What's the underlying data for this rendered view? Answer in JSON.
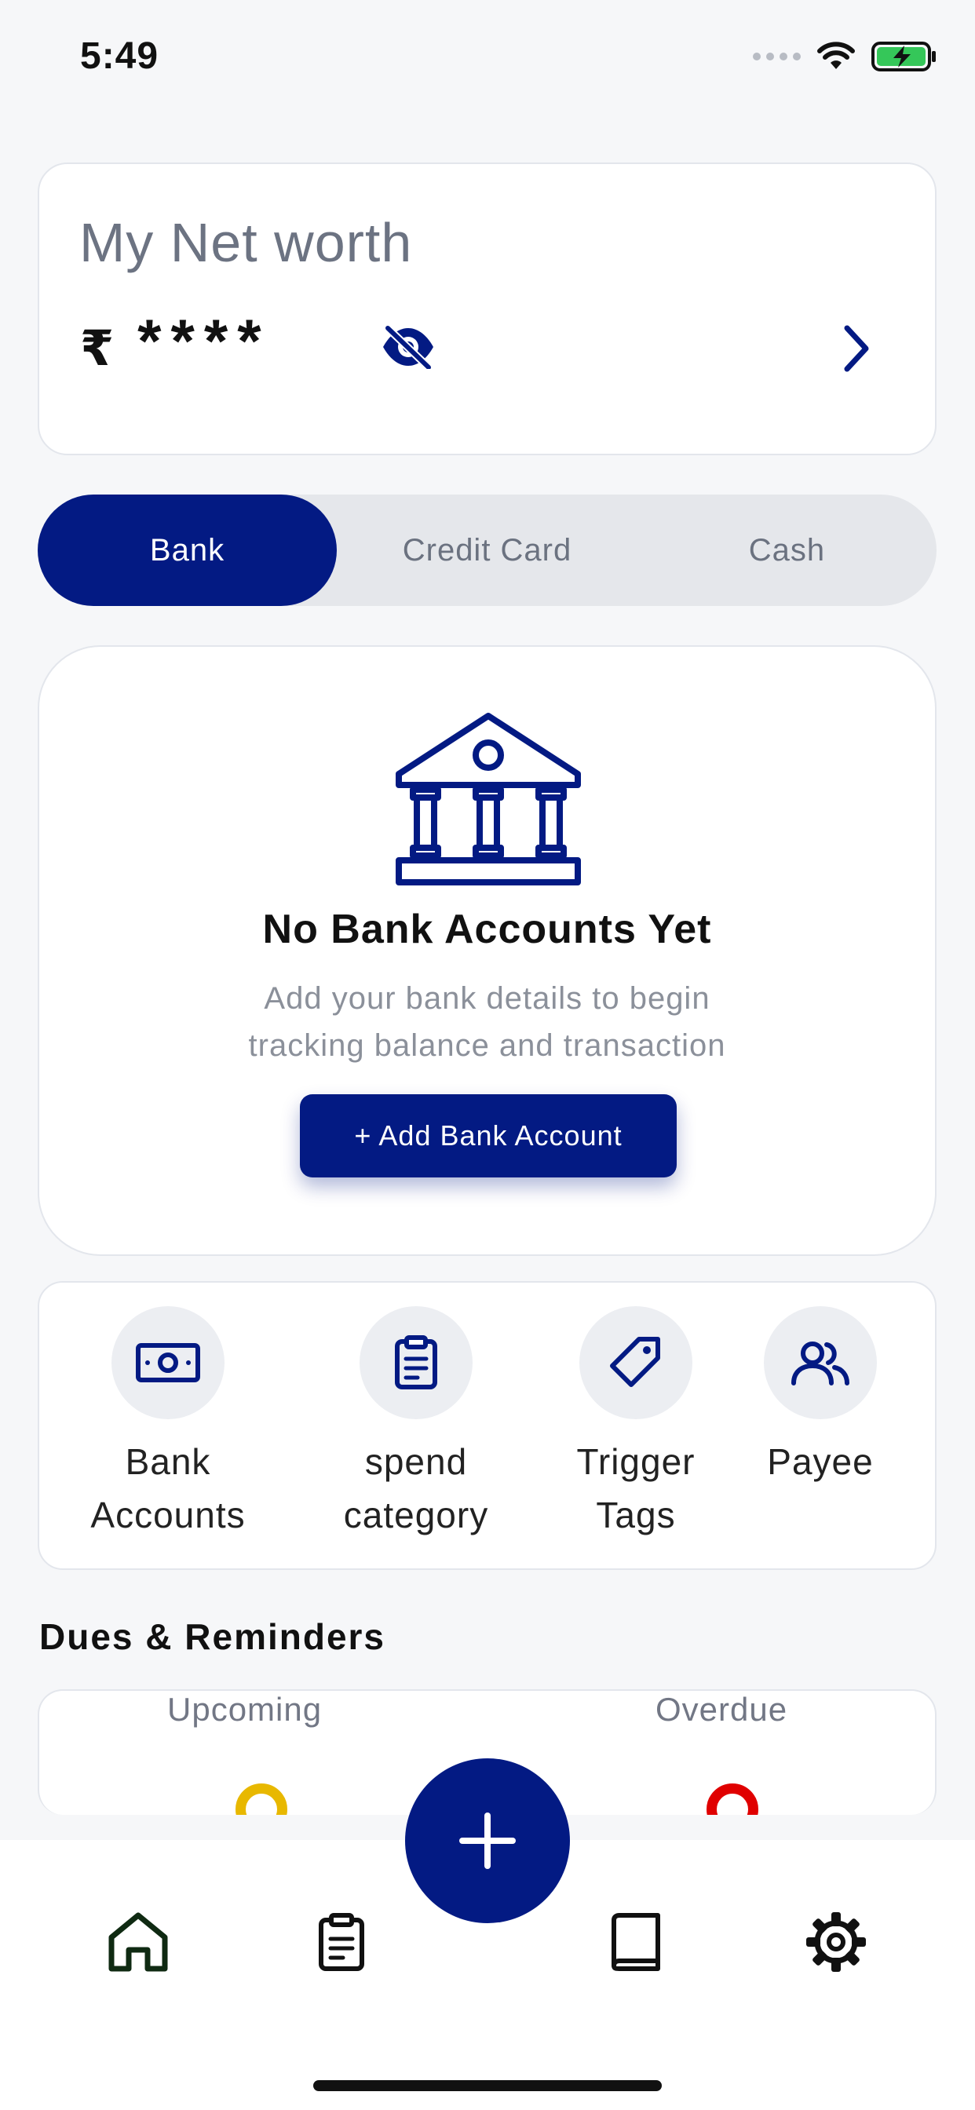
{
  "status": {
    "time": "5:49",
    "icons": [
      "signal-icon",
      "wifi-icon",
      "battery-charging-icon"
    ]
  },
  "net_worth": {
    "title": "My Net worth",
    "currency": "₹",
    "masked_value": "****",
    "icons": [
      "eye-off-icon",
      "chevron-right-icon"
    ]
  },
  "tabs": [
    {
      "label": "Bank",
      "active": true
    },
    {
      "label": "Credit Card",
      "active": false
    },
    {
      "label": "Cash",
      "active": false
    }
  ],
  "empty_state": {
    "icon": "bank-building-icon",
    "title": "No Bank Accounts Yet",
    "desc_line1": "Add your bank details to begin",
    "desc_line2": "tracking balance and transaction",
    "button": "+ Add Bank Account"
  },
  "quick_actions": [
    {
      "line1": "Bank",
      "line2": "Accounts",
      "icon": "banknote-icon"
    },
    {
      "line1": "spend",
      "line2": "category",
      "icon": "clipboard-icon"
    },
    {
      "line1": "Trigger",
      "line2": "Tags",
      "icon": "tag-icon"
    },
    {
      "line1": "Payee",
      "line2": "",
      "icon": "users-icon"
    }
  ],
  "dues": {
    "title": "Dues & Reminders",
    "upcoming": "Upcoming",
    "overdue": "Overdue",
    "colors": {
      "upcoming": "#e8b800",
      "overdue": "#e00000"
    }
  },
  "bottom_nav": {
    "items": [
      "home-icon",
      "clipboard-icon",
      "book-icon",
      "gear-icon"
    ],
    "fab": "plus-icon"
  },
  "colors": {
    "primary": "#031a83",
    "background": "#f6f7f9",
    "muted": "#6c7382"
  }
}
